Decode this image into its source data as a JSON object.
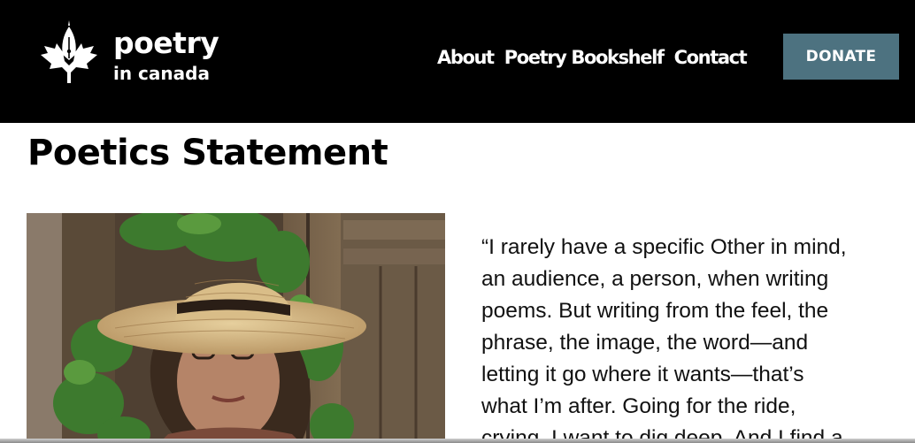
{
  "header": {
    "logo": {
      "word": "poetry",
      "sub": "in canada",
      "icon": "maple-leaf-pen-nib-icon"
    },
    "nav": [
      {
        "label": "About"
      },
      {
        "label": "Poetry Bookshelf"
      },
      {
        "label": "Contact"
      }
    ],
    "donate_label": "DONATE",
    "colors": {
      "bar": "#000000",
      "donate": "#4d7280"
    }
  },
  "main": {
    "title": "Poetics Statement",
    "photo": {
      "subject": "author-portrait"
    },
    "quote_lines": [
      "“I rarely have a specific Other in mind,",
      "an audience, a person, when writing",
      "poems. But writing from the feel, the",
      "phrase, the image, the word—and",
      "letting it go where it wants—that’s",
      "what I’m after. Going for the ride,",
      "crying, I want to dig deep. And I find a"
    ]
  }
}
